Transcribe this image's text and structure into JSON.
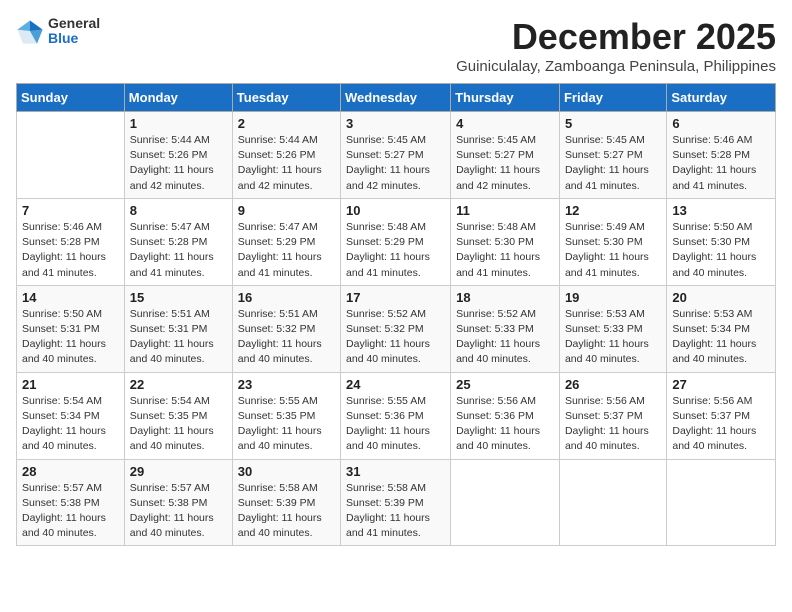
{
  "logo": {
    "general": "General",
    "blue": "Blue"
  },
  "title": "December 2025",
  "subtitle": "Guiniculalay, Zamboanga Peninsula, Philippines",
  "headers": [
    "Sunday",
    "Monday",
    "Tuesday",
    "Wednesday",
    "Thursday",
    "Friday",
    "Saturday"
  ],
  "weeks": [
    [
      {
        "day": "",
        "info": ""
      },
      {
        "day": "1",
        "info": "Sunrise: 5:44 AM\nSunset: 5:26 PM\nDaylight: 11 hours\nand 42 minutes."
      },
      {
        "day": "2",
        "info": "Sunrise: 5:44 AM\nSunset: 5:26 PM\nDaylight: 11 hours\nand 42 minutes."
      },
      {
        "day": "3",
        "info": "Sunrise: 5:45 AM\nSunset: 5:27 PM\nDaylight: 11 hours\nand 42 minutes."
      },
      {
        "day": "4",
        "info": "Sunrise: 5:45 AM\nSunset: 5:27 PM\nDaylight: 11 hours\nand 42 minutes."
      },
      {
        "day": "5",
        "info": "Sunrise: 5:45 AM\nSunset: 5:27 PM\nDaylight: 11 hours\nand 41 minutes."
      },
      {
        "day": "6",
        "info": "Sunrise: 5:46 AM\nSunset: 5:28 PM\nDaylight: 11 hours\nand 41 minutes."
      }
    ],
    [
      {
        "day": "7",
        "info": "Sunrise: 5:46 AM\nSunset: 5:28 PM\nDaylight: 11 hours\nand 41 minutes."
      },
      {
        "day": "8",
        "info": "Sunrise: 5:47 AM\nSunset: 5:28 PM\nDaylight: 11 hours\nand 41 minutes."
      },
      {
        "day": "9",
        "info": "Sunrise: 5:47 AM\nSunset: 5:29 PM\nDaylight: 11 hours\nand 41 minutes."
      },
      {
        "day": "10",
        "info": "Sunrise: 5:48 AM\nSunset: 5:29 PM\nDaylight: 11 hours\nand 41 minutes."
      },
      {
        "day": "11",
        "info": "Sunrise: 5:48 AM\nSunset: 5:30 PM\nDaylight: 11 hours\nand 41 minutes."
      },
      {
        "day": "12",
        "info": "Sunrise: 5:49 AM\nSunset: 5:30 PM\nDaylight: 11 hours\nand 41 minutes."
      },
      {
        "day": "13",
        "info": "Sunrise: 5:50 AM\nSunset: 5:30 PM\nDaylight: 11 hours\nand 40 minutes."
      }
    ],
    [
      {
        "day": "14",
        "info": "Sunrise: 5:50 AM\nSunset: 5:31 PM\nDaylight: 11 hours\nand 40 minutes."
      },
      {
        "day": "15",
        "info": "Sunrise: 5:51 AM\nSunset: 5:31 PM\nDaylight: 11 hours\nand 40 minutes."
      },
      {
        "day": "16",
        "info": "Sunrise: 5:51 AM\nSunset: 5:32 PM\nDaylight: 11 hours\nand 40 minutes."
      },
      {
        "day": "17",
        "info": "Sunrise: 5:52 AM\nSunset: 5:32 PM\nDaylight: 11 hours\nand 40 minutes."
      },
      {
        "day": "18",
        "info": "Sunrise: 5:52 AM\nSunset: 5:33 PM\nDaylight: 11 hours\nand 40 minutes."
      },
      {
        "day": "19",
        "info": "Sunrise: 5:53 AM\nSunset: 5:33 PM\nDaylight: 11 hours\nand 40 minutes."
      },
      {
        "day": "20",
        "info": "Sunrise: 5:53 AM\nSunset: 5:34 PM\nDaylight: 11 hours\nand 40 minutes."
      }
    ],
    [
      {
        "day": "21",
        "info": "Sunrise: 5:54 AM\nSunset: 5:34 PM\nDaylight: 11 hours\nand 40 minutes."
      },
      {
        "day": "22",
        "info": "Sunrise: 5:54 AM\nSunset: 5:35 PM\nDaylight: 11 hours\nand 40 minutes."
      },
      {
        "day": "23",
        "info": "Sunrise: 5:55 AM\nSunset: 5:35 PM\nDaylight: 11 hours\nand 40 minutes."
      },
      {
        "day": "24",
        "info": "Sunrise: 5:55 AM\nSunset: 5:36 PM\nDaylight: 11 hours\nand 40 minutes."
      },
      {
        "day": "25",
        "info": "Sunrise: 5:56 AM\nSunset: 5:36 PM\nDaylight: 11 hours\nand 40 minutes."
      },
      {
        "day": "26",
        "info": "Sunrise: 5:56 AM\nSunset: 5:37 PM\nDaylight: 11 hours\nand 40 minutes."
      },
      {
        "day": "27",
        "info": "Sunrise: 5:56 AM\nSunset: 5:37 PM\nDaylight: 11 hours\nand 40 minutes."
      }
    ],
    [
      {
        "day": "28",
        "info": "Sunrise: 5:57 AM\nSunset: 5:38 PM\nDaylight: 11 hours\nand 40 minutes."
      },
      {
        "day": "29",
        "info": "Sunrise: 5:57 AM\nSunset: 5:38 PM\nDaylight: 11 hours\nand 40 minutes."
      },
      {
        "day": "30",
        "info": "Sunrise: 5:58 AM\nSunset: 5:39 PM\nDaylight: 11 hours\nand 40 minutes."
      },
      {
        "day": "31",
        "info": "Sunrise: 5:58 AM\nSunset: 5:39 PM\nDaylight: 11 hours\nand 41 minutes."
      },
      {
        "day": "",
        "info": ""
      },
      {
        "day": "",
        "info": ""
      },
      {
        "day": "",
        "info": ""
      }
    ]
  ]
}
